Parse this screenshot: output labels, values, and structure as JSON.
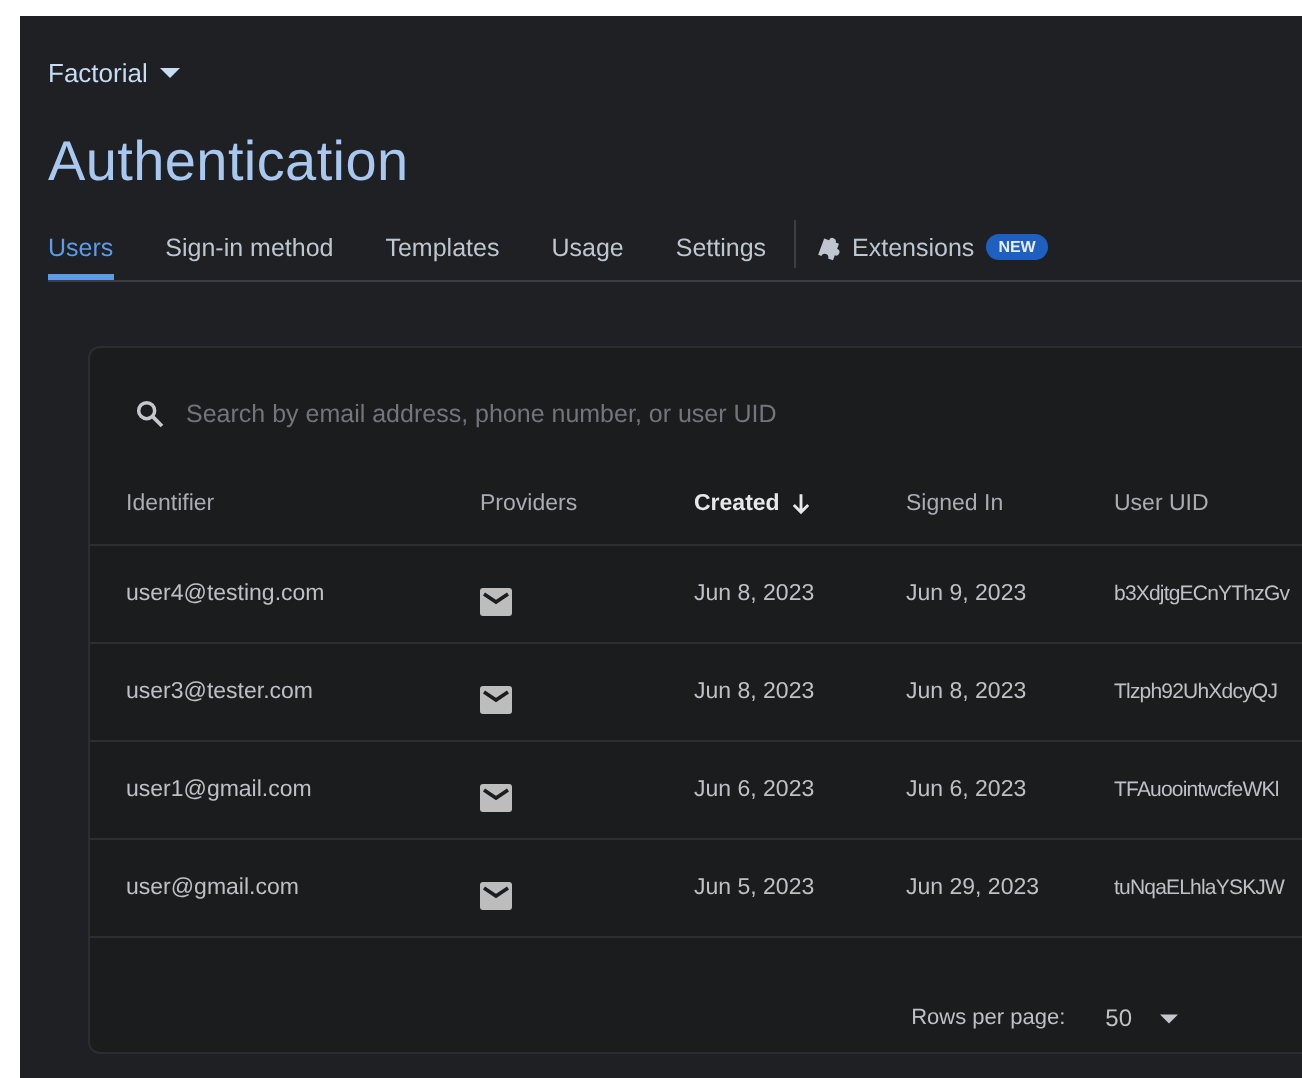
{
  "project": {
    "name": "Factorial"
  },
  "title": "Authentication",
  "tabs": [
    {
      "label": "Users",
      "selected": true
    },
    {
      "label": "Sign-in method",
      "selected": false
    },
    {
      "label": "Templates",
      "selected": false
    },
    {
      "label": "Usage",
      "selected": false
    },
    {
      "label": "Settings",
      "selected": false
    },
    {
      "label": "Extensions",
      "selected": false,
      "badge": "NEW"
    }
  ],
  "search": {
    "placeholder": "Search by email address, phone number, or user UID"
  },
  "table": {
    "columns": [
      {
        "label": "Identifier",
        "sorted": false
      },
      {
        "label": "Providers",
        "sorted": false
      },
      {
        "label": "Created",
        "sorted": true
      },
      {
        "label": "Signed In",
        "sorted": false
      },
      {
        "label": "User UID",
        "sorted": false
      }
    ],
    "rows": [
      {
        "identifier": "user4@testing.com",
        "created": "Jun 8, 2023",
        "signed_in": "Jun 9, 2023",
        "uid": "b3XdjtgECnYThzGv"
      },
      {
        "identifier": "user3@tester.com",
        "created": "Jun 8, 2023",
        "signed_in": "Jun 8, 2023",
        "uid": "Tlzph92UhXdcyQJ"
      },
      {
        "identifier": "user1@gmail.com",
        "created": "Jun 6, 2023",
        "signed_in": "Jun 6, 2023",
        "uid": "TFAuoointwcfeWKl"
      },
      {
        "identifier": "user@gmail.com",
        "created": "Jun 5, 2023",
        "signed_in": "Jun 29, 2023",
        "uid": "tuNqaELhlaYSKJW"
      }
    ]
  },
  "pagination": {
    "rows_per_page_label": "Rows per page:",
    "rows_per_page": "50"
  }
}
